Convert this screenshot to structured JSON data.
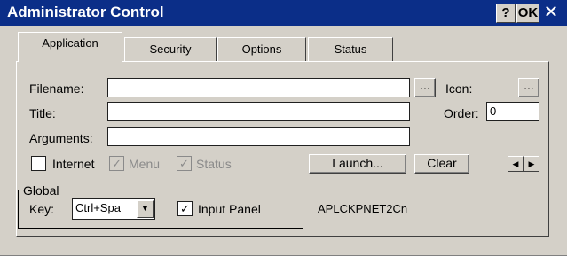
{
  "window": {
    "title": "Administrator Control",
    "help_label": "?",
    "ok_label": "OK",
    "close_label": "✕"
  },
  "tabs": [
    {
      "label": "Application",
      "active": true
    },
    {
      "label": "Security",
      "active": false
    },
    {
      "label": "Options",
      "active": false
    },
    {
      "label": "Status",
      "active": false
    }
  ],
  "application": {
    "filename_label": "Filename:",
    "filename_value": "",
    "browse_label": "...",
    "icon_label": "Icon:",
    "icon_browse_label": "...",
    "title_label": "Title:",
    "title_value": "",
    "order_label": "Order:",
    "order_value": "0",
    "arguments_label": "Arguments:",
    "arguments_value": "",
    "internet_label": "Internet",
    "internet_checked": false,
    "menu_label": "Menu",
    "menu_checked": true,
    "status_label": "Status",
    "status_checked": true,
    "launch_label": "Launch...",
    "clear_label": "Clear",
    "prev_glyph": "◀",
    "next_glyph": "▶"
  },
  "global": {
    "group_label": "Global",
    "key_label": "Key:",
    "key_value": "Ctrl+Spa",
    "combo_glyph": "▼",
    "input_panel_label": "Input Panel",
    "input_panel_checked": true,
    "check_glyph": "✓",
    "device_name": "APLCKPNET2Cn"
  },
  "colors": {
    "titlebar": "#0b2e88",
    "face": "#d4d0c8",
    "disabled_text": "#8a8a8a"
  }
}
